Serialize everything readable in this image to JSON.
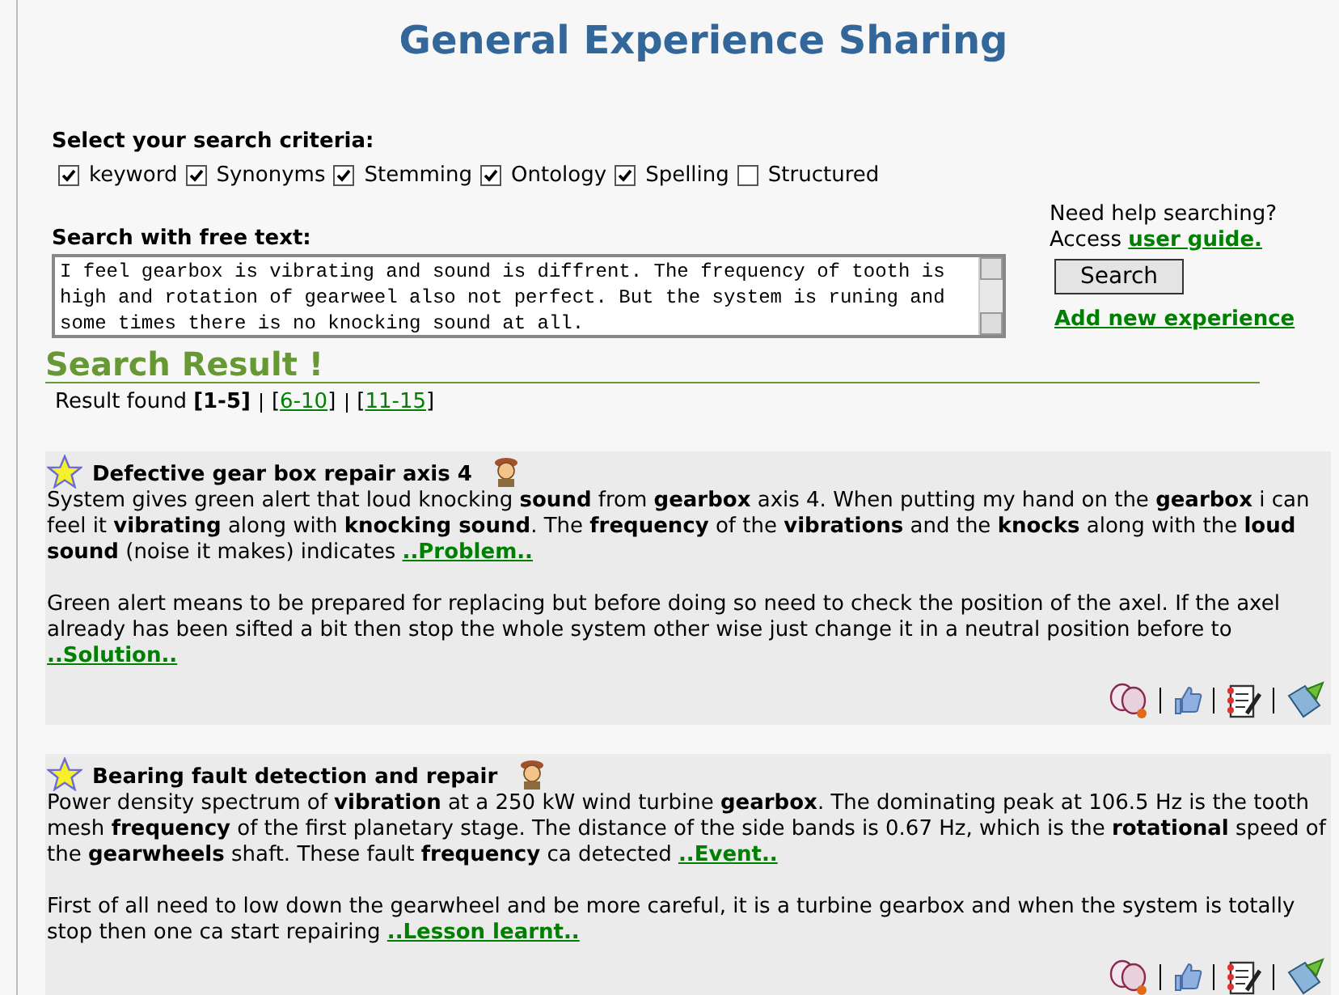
{
  "title": "General Experience Sharing",
  "criteria": {
    "label": "Select your search criteria:",
    "options": [
      {
        "label": "keyword",
        "checked": true
      },
      {
        "label": "Synonyms",
        "checked": true
      },
      {
        "label": "Stemming",
        "checked": true
      },
      {
        "label": "Ontology",
        "checked": true
      },
      {
        "label": "Spelling",
        "checked": true
      },
      {
        "label": "Structured",
        "checked": false
      }
    ]
  },
  "free_text": {
    "label": "Search with free text:",
    "value": "I feel gearbox is vibrating and sound is diffrent. The frequency of tooth is high and rotation of gearweel also not perfect. But the system is runing and some times there is no knocking sound at all."
  },
  "help": {
    "question": "Need help searching?",
    "prefix": "Access",
    "link": "user guide.",
    "search_button": "Search",
    "add_link": "Add new experience"
  },
  "results": {
    "heading": "Search Result !",
    "found_label": "Result found",
    "pages": [
      {
        "open": "[",
        "label": "1-5",
        "close": "]",
        "selected": true
      },
      {
        "open": "[",
        "label": "6-10",
        "close": "]",
        "selected": false
      },
      {
        "open": "[",
        "label": "11-15",
        "close": "]",
        "selected": false
      }
    ],
    "items": [
      {
        "title": "Defective gear box repair axis 4",
        "paragraphs": [
          {
            "text": "System gives green alert that loud knocking **sound** from **gearbox** axis 4. When putting my hand on the **gearbox** i can feel it **vibrating** along with **knocking sound**. The **frequency** of the **vibrations** and the **knocks** along with the **loud sound** (noise it makes) indicates",
            "link": "..Problem.."
          },
          {
            "text": "Green alert means to be prepared for replacing but before doing so need to check the position of the axel. If the axel already has been sifted a bit then stop the whole system other wise just change it in a neutral position before to",
            "link": "..Solution.."
          }
        ]
      },
      {
        "title": "Bearing fault detection and repair",
        "paragraphs": [
          {
            "text": "Power density spectrum of **vibration** at a 250 kW wind turbine **gearbox**. The dominating peak at 106.5 Hz is the tooth mesh **frequency** of the first planetary stage. The distance of the side bands is 0.67 Hz, which is the **rotational** speed of the **gearwheels** shaft. These fault **frequency** ca detected",
            "link": "..Event.."
          },
          {
            "text": "First of all need to low down the gearwheel and be more careful, it is a turbine gearbox and when the system is totally stop then one ca start repairing",
            "link": "..Lesson learnt.."
          }
        ]
      }
    ]
  }
}
